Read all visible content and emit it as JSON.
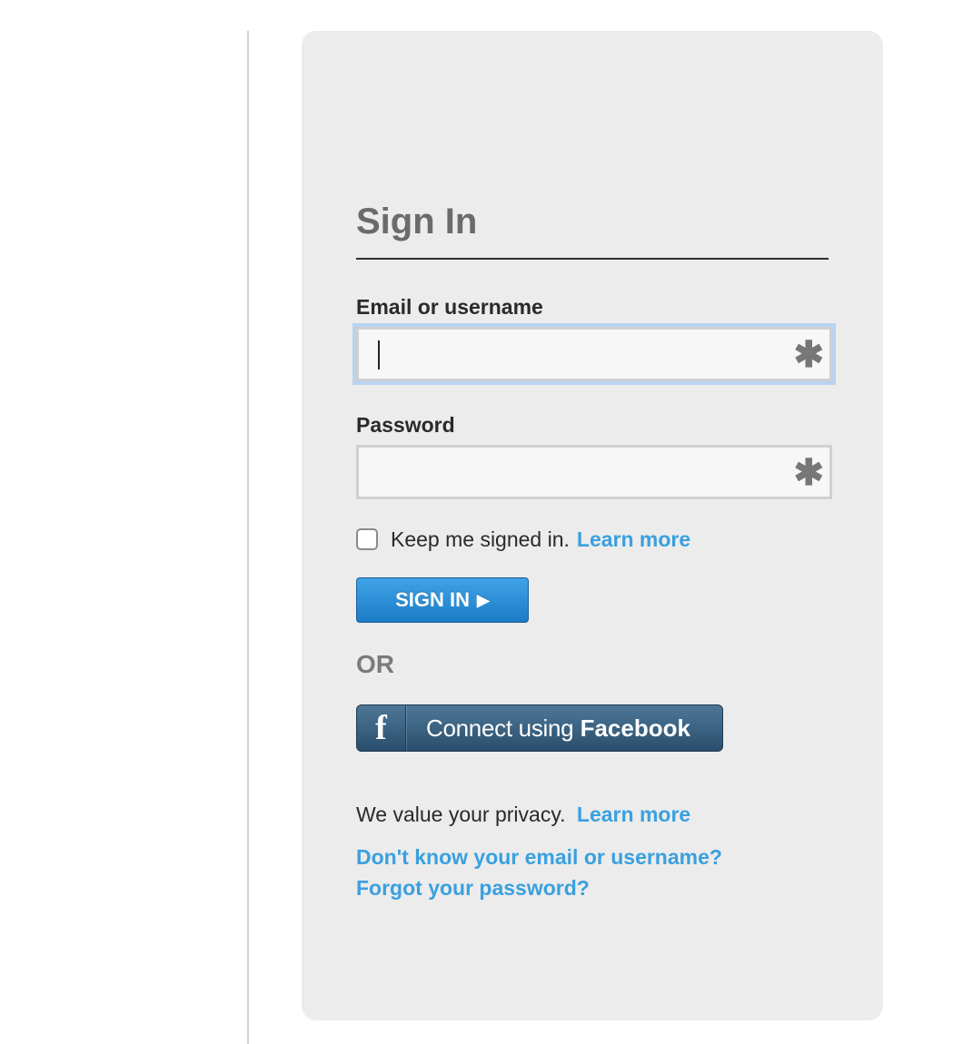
{
  "signin": {
    "title": "Sign In",
    "email_label": "Email or username",
    "email_value": "",
    "password_label": "Password",
    "password_value": "",
    "required_marker": "✱",
    "keep_signed_in_text": "Keep me signed in.",
    "keep_signed_in_link": "Learn more",
    "keep_signed_in_checked": false,
    "submit_label": "SIGN IN",
    "submit_arrow": "▶",
    "or_text": "OR",
    "facebook_icon": "f",
    "facebook_prefix": "Connect using",
    "facebook_brand": "Facebook",
    "privacy_text": "We value your privacy.",
    "privacy_link": "Learn more",
    "forgot_username_link": "Don't know your email or username?",
    "forgot_password_link": "Forgot your password?"
  },
  "colors": {
    "panel_background": "#ececec",
    "link": "#3aa0df",
    "primary_button": "#1c7cc7",
    "facebook_button": "#2a4e6c",
    "focus_ring": "#b7d4f1"
  }
}
